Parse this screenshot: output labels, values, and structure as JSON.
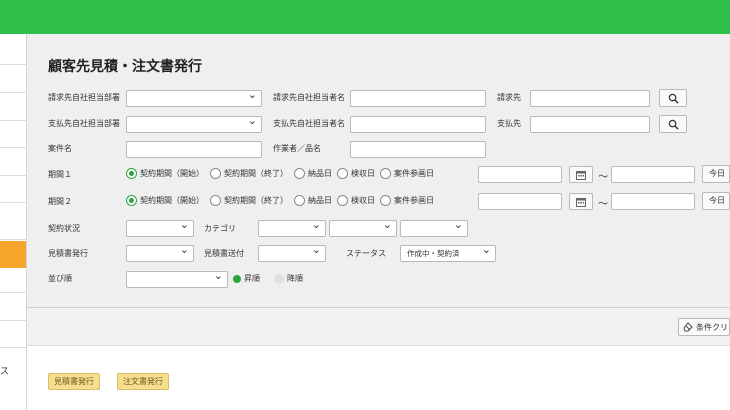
{
  "title": "顧客先見積・注文書発行",
  "labels": {
    "billing_dept": "請求先自社担当部署",
    "billing_person": "請求先自社担当者名",
    "billing_to": "請求先",
    "payment_dept": "支払先自社担当部署",
    "payment_person": "支払先自社担当者名",
    "payment_to": "支払先",
    "case_name": "案件名",
    "work_name": "作業者／品名",
    "period1": "期間１",
    "period2": "期間２",
    "contract_status": "契約状況",
    "category": "カテゴリ",
    "estimate_issue": "見積書発行",
    "estimate_send": "見積書送付",
    "status": "ステータス",
    "sort": "並び順"
  },
  "period_options": [
    "契約期間（開始）",
    "契約期間（終了）",
    "納品日",
    "検収日",
    "案件参画日"
  ],
  "period1_selected": "契約期間（開始）",
  "period2_selected": "契約期間（開始）",
  "status_value": "作成中・契約済",
  "sort_options": [
    "昇順",
    "降順"
  ],
  "sort_selected": "昇順",
  "tilde": "～",
  "today_label": "今日",
  "clear_button": "条件クリ",
  "sidebar_text": "ス",
  "bottom_buttons": [
    "見積書発行",
    "注文書発行"
  ],
  "icons": {
    "search": "search-icon",
    "calendar": "calendar-icon",
    "eraser": "eraser-icon"
  },
  "colors": {
    "header": "#2fbf4a",
    "accent": "#f4a52a",
    "radio_on": "#2aa33f",
    "action_button": "#f7dd8e"
  }
}
